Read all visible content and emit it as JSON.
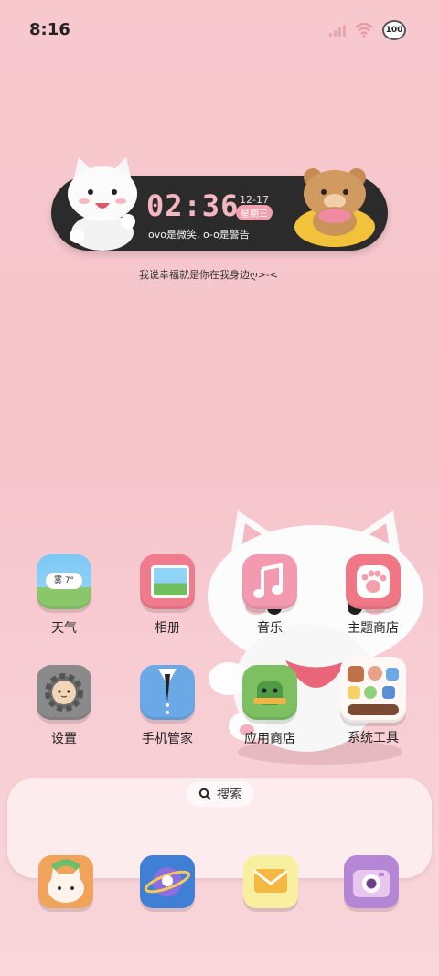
{
  "status": {
    "time": "8:16",
    "battery": "100"
  },
  "widget": {
    "clock": "02:36",
    "date": "12-17",
    "weekday": "星期三",
    "motto": "ovo是微笑, o-o是警告"
  },
  "tagline": "我说幸福就是你在我身边ღ>-<",
  "apps": [
    {
      "label": "天气",
      "icon": "weather-icon",
      "icon_text": "雾 7°"
    },
    {
      "label": "相册",
      "icon": "gallery-icon"
    },
    {
      "label": "音乐",
      "icon": "music-icon"
    },
    {
      "label": "主题商店",
      "icon": "theme-store-icon"
    },
    {
      "label": "设置",
      "icon": "settings-icon"
    },
    {
      "label": "手机管家",
      "icon": "phone-manager-icon"
    },
    {
      "label": "应用商店",
      "icon": "app-store-icon"
    },
    {
      "label": "系统工具",
      "icon": "system-tools-folder-icon"
    }
  ],
  "search": {
    "label": "搜索"
  },
  "dock": [
    {
      "icon": "phone-icon"
    },
    {
      "icon": "browser-icon"
    },
    {
      "icon": "messages-icon"
    },
    {
      "icon": "camera-icon"
    }
  ]
}
